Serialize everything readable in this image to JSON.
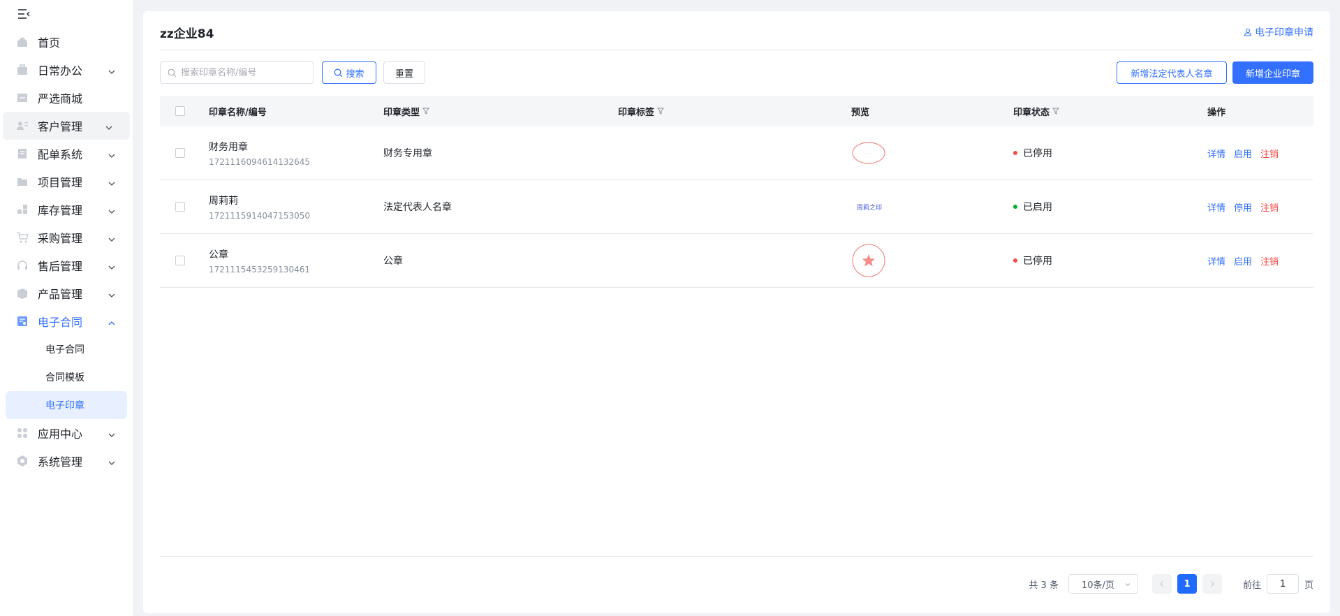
{
  "sidebar": {
    "items": [
      {
        "label": "首页",
        "icon": "home-icon"
      },
      {
        "label": "日常办公",
        "icon": "briefcase-icon"
      },
      {
        "label": "严选商城",
        "icon": "mall-icon"
      },
      {
        "label": "客户管理",
        "icon": "customer-icon"
      },
      {
        "label": "配单系统",
        "icon": "order-icon"
      },
      {
        "label": "项目管理",
        "icon": "folder-icon"
      },
      {
        "label": "库存管理",
        "icon": "inventory-icon"
      },
      {
        "label": "采购管理",
        "icon": "cart-icon"
      },
      {
        "label": "售后管理",
        "icon": "headset-icon"
      },
      {
        "label": "产品管理",
        "icon": "box-icon"
      },
      {
        "label": "电子合同",
        "icon": "contract-icon"
      },
      {
        "label": "应用中心",
        "icon": "apps-icon"
      },
      {
        "label": "系统管理",
        "icon": "settings-icon"
      }
    ],
    "contract_sub": [
      "电子合同",
      "合同模板",
      "电子印章"
    ]
  },
  "header": {
    "title": "zz企业84",
    "apply_link": "电子印章申请"
  },
  "toolbar": {
    "search_placeholder": "搜索印章名称/编号",
    "search_label": "搜索",
    "reset_label": "重置",
    "add_legal_label": "新增法定代表人名章",
    "add_company_label": "新增企业印章"
  },
  "table": {
    "headers": {
      "name": "印章名称/编号",
      "type": "印章类型",
      "tag": "印章标签",
      "preview": "预览",
      "status": "印章状态",
      "ops": "操作"
    },
    "rows": [
      {
        "name": "财务用章",
        "code": "1721116094614132645",
        "type": "财务专用章",
        "preview": "oval-seal",
        "status": "已停用",
        "status_color": "#f54a45",
        "toggle_label": "启用"
      },
      {
        "name": "周莉莉",
        "code": "1721115914047153050",
        "type": "法定代表人名章",
        "preview": "name-seal",
        "preview_text": "周莉之印",
        "status": "已启用",
        "status_color": "#00b42a",
        "toggle_label": "停用"
      },
      {
        "name": "公章",
        "code": "1721115453259130461",
        "type": "公章",
        "preview": "round-star-seal",
        "status": "已停用",
        "status_color": "#f54a45",
        "toggle_label": "启用"
      }
    ],
    "detail_label": "详情",
    "cancel_label": "注销"
  },
  "pagination": {
    "total": "共 3 条",
    "page_size": "10条/页",
    "current": "1",
    "goto_prefix": "前往",
    "goto_value": "1",
    "goto_suffix": "页"
  },
  "colors": {
    "accent": "#3370ff",
    "danger": "#f54a45",
    "success": "#00b42a"
  }
}
